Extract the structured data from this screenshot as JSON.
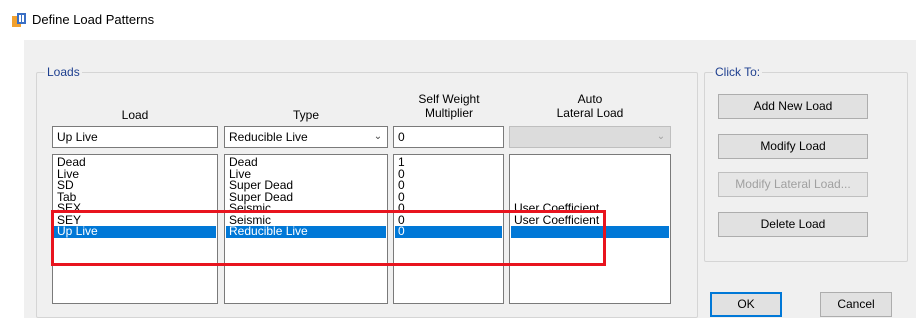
{
  "window": {
    "title": "Define Load Patterns",
    "icon": "app-icon"
  },
  "loads_group": {
    "caption": "Loads",
    "headers": {
      "load": "Load",
      "type": "Type",
      "self_weight": "Self Weight\nMultiplier",
      "auto_lateral": "Auto\nLateral Load"
    },
    "editor": {
      "load": "Up Live",
      "type": "Reducible Live",
      "self_weight": "0",
      "auto_lateral": ""
    },
    "rows": [
      {
        "load": "Dead",
        "type": "Dead",
        "self_weight": "1",
        "auto_lateral": ""
      },
      {
        "load": "Live",
        "type": "Live",
        "self_weight": "0",
        "auto_lateral": ""
      },
      {
        "load": "SD",
        "type": "Super Dead",
        "self_weight": "0",
        "auto_lateral": ""
      },
      {
        "load": "Tab",
        "type": "Super Dead",
        "self_weight": "0",
        "auto_lateral": ""
      },
      {
        "load": "SEX",
        "type": "Seismic",
        "self_weight": "0",
        "auto_lateral": "User Coefficient"
      },
      {
        "load": "SEY",
        "type": "Seismic",
        "self_weight": "0",
        "auto_lateral": "User Coefficient"
      },
      {
        "load": "Up Live",
        "type": "Reducible Live",
        "self_weight": "0",
        "auto_lateral": "",
        "selected": true
      }
    ]
  },
  "click_to_group": {
    "caption": "Click To:",
    "buttons": {
      "add": "Add New Load",
      "modify": "Modify Load",
      "modify_lateral": "Modify Lateral Load...",
      "delete": "Delete Load"
    }
  },
  "dialog_buttons": {
    "ok": "OK",
    "cancel": "Cancel"
  },
  "colors": {
    "selection": "#0078d7",
    "annotation": "#e8141e",
    "caption": "#1e3f8f"
  }
}
